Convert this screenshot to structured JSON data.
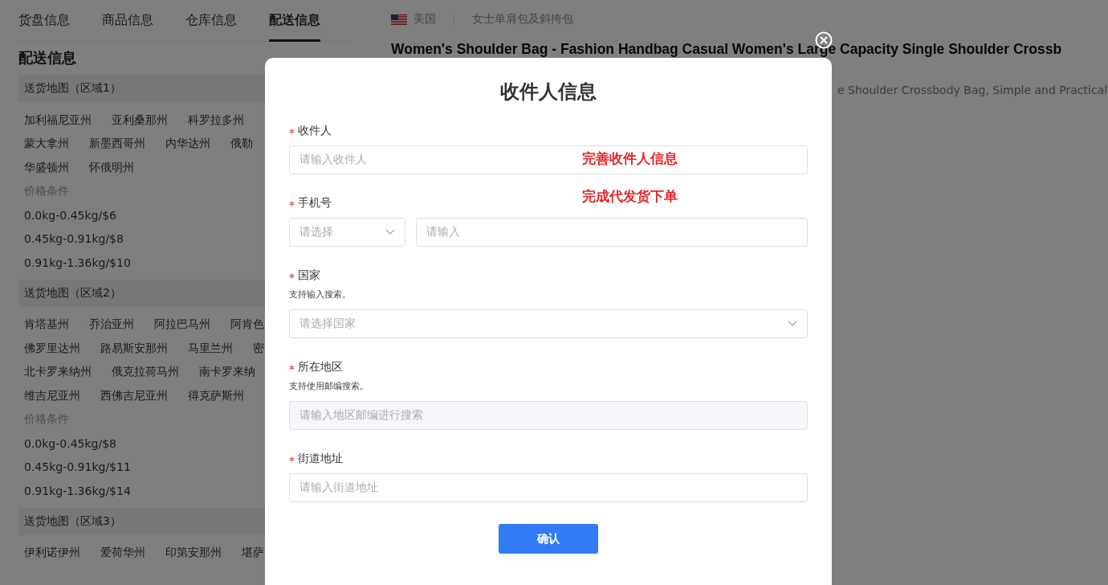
{
  "tabs": [
    {
      "label": "货盘信息",
      "selected": false
    },
    {
      "label": "商品信息",
      "selected": false
    },
    {
      "label": "仓库信息",
      "selected": false
    },
    {
      "label": "配送信息",
      "selected": true
    }
  ],
  "section_title": "配送信息",
  "regions": [
    {
      "title": "送货地图（区域1）",
      "states": [
        [
          "加利福尼亚州",
          "亚利桑那州",
          "科罗拉多州"
        ],
        [
          "蒙大拿州",
          "新墨西哥州",
          "内华达州",
          "俄勒"
        ],
        [
          "华盛顿州",
          "怀俄明州"
        ]
      ],
      "price_label": "价格条件",
      "prices": [
        "0.0kg-0.45kg/$6",
        "0.45kg-0.91kg/$8",
        "0.91kg-1.36kg/$10"
      ]
    },
    {
      "title": "送货地图（区域2）",
      "states": [
        [
          "肯塔基州",
          "乔治亚州",
          "阿拉巴马州",
          "阿肯色"
        ],
        [
          "佛罗里达州",
          "路易斯安那州",
          "马里兰州",
          "密"
        ],
        [
          "北卡罗来纳州",
          "俄克拉荷马州",
          "南卡罗来纳"
        ],
        [
          "维吉尼亚州",
          "西佛吉尼亚州",
          "得克萨斯州"
        ]
      ],
      "price_label": "价格条件",
      "prices": [
        "0.0kg-0.45kg/$8",
        "0.45kg-0.91kg/$11",
        "0.91kg-1.36kg/$14"
      ]
    },
    {
      "title": "送货地图（区域3）",
      "states": [
        [
          "伊利诺伊州",
          "爱荷华州",
          "印第安那州",
          "堪萨"
        ]
      ]
    }
  ],
  "product": {
    "country": "美国",
    "category": "女士单肩包及斜挎包",
    "title": "Women's Shoulder Bag - Fashion Handbag Casual Women's Large Capacity Single Shoulder Crossb",
    "subtitle": "e Shoulder Crossbody Bag, Simple and Practical"
  },
  "modal": {
    "title": "收件人信息",
    "fields": [
      {
        "kind": "input",
        "label": "收件人",
        "required": true,
        "placeholder": "请输入收件人"
      },
      {
        "kind": "phone",
        "label": "手机号",
        "required": true,
        "code_placeholder": "请选择",
        "placeholder": "请输入"
      },
      {
        "kind": "select",
        "label": "国家",
        "required": true,
        "hint": "支持输入搜索。",
        "placeholder": "请选择国家"
      },
      {
        "kind": "disabled",
        "label": "所在地区",
        "required": true,
        "hint": "支持使用邮编搜索。",
        "placeholder": "请输入地区邮编进行搜索"
      },
      {
        "kind": "input",
        "label": "街道地址",
        "required": true,
        "placeholder": "请输入街道地址"
      }
    ],
    "annotations": [
      "完善收件人信息",
      "完成代发货下单"
    ],
    "confirm": "确认"
  }
}
